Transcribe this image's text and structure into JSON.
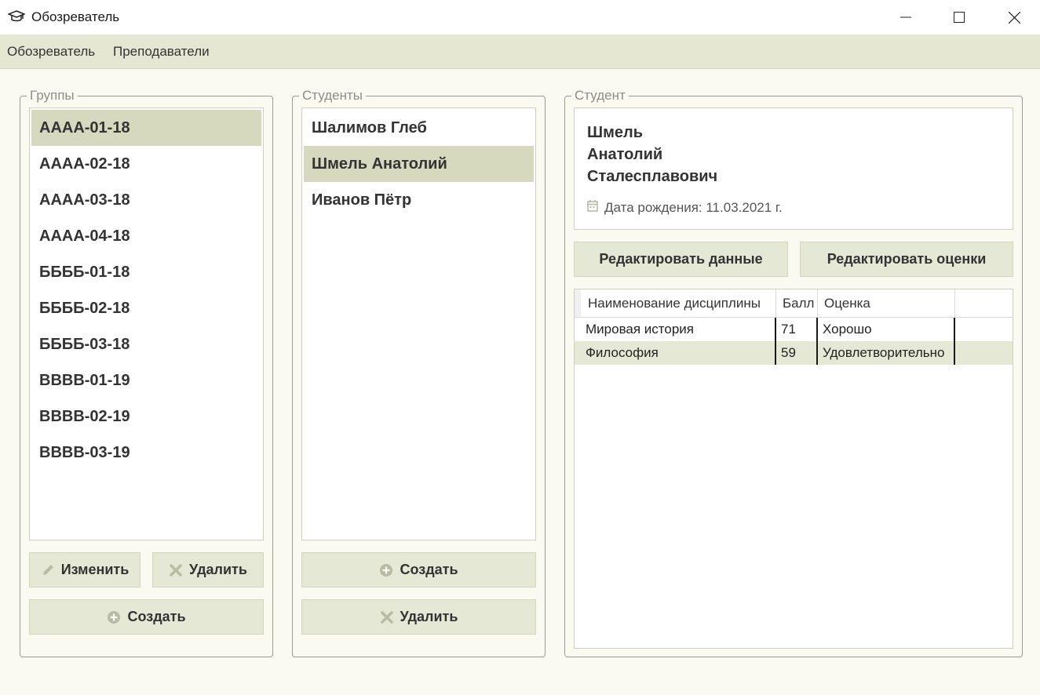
{
  "window": {
    "title": "Обозреватель",
    "icon": "graduation-cap-icon"
  },
  "menu": {
    "items": [
      "Обозреватель",
      "Преподаватели"
    ]
  },
  "groups": {
    "legend": "Группы",
    "items": [
      "АААА-01-18",
      "АААА-02-18",
      "АААА-03-18",
      "АААА-04-18",
      "ББББ-01-18",
      "ББББ-02-18",
      "ББББ-03-18",
      "ВВВВ-01-19",
      "ВВВВ-02-19",
      "ВВВВ-03-19"
    ],
    "selected": "АААА-01-18",
    "edit_label": "Изменить",
    "delete_label": "Удалить",
    "create_label": "Создать"
  },
  "students": {
    "legend": "Студенты",
    "items": [
      "Шалимов Глеб",
      "Шмель Анатолий",
      "Иванов Пётр"
    ],
    "selected": "Шмель Анатолий",
    "create_label": "Создать",
    "delete_label": "Удалить"
  },
  "student": {
    "legend": "Студент",
    "last_name": "Шмель",
    "first_name": "Анатолий",
    "patronymic": "Сталесплавович",
    "birth_text": "Дата рождения: 11.03.2021 г.",
    "edit_data_label": "Редактировать данные",
    "edit_grades_label": "Редактировать оценки"
  },
  "grades": {
    "columns": [
      "Наименование дисциплины",
      "Балл",
      "Оценка"
    ],
    "rows": [
      [
        "Мировая история",
        "71",
        "Хорошо"
      ],
      [
        "Философия",
        "59",
        "Удовлетворительно"
      ]
    ]
  },
  "colors": {
    "accent_selected": "#d6d9bd",
    "menubar": "#e6e7d3",
    "background": "#fbfaf0",
    "button": "#e6e8d6"
  }
}
